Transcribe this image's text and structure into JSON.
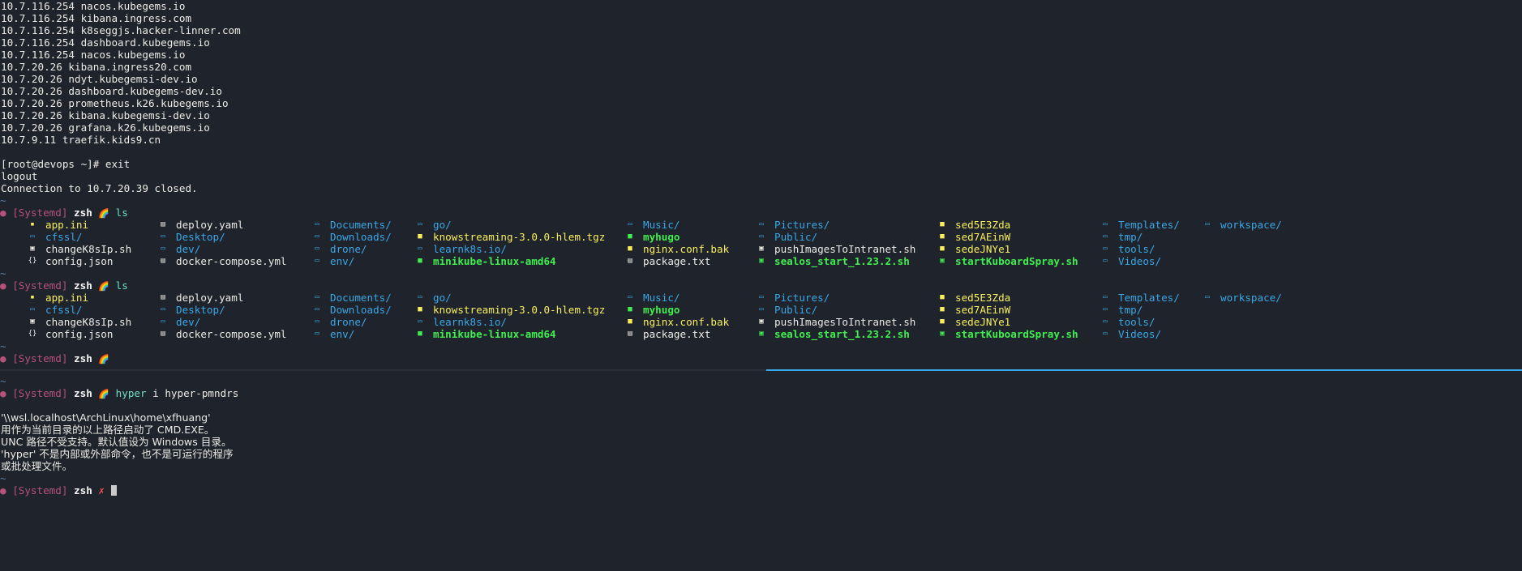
{
  "colors": {
    "background": "#1f232b",
    "text": "#ecebe6",
    "directory": "#3aa7e6",
    "executable": "#42ed51",
    "config_file": "#f8ef5f",
    "prompt_tag": "#b4537a",
    "command_ok": "#6fe0c4",
    "error_mark": "#ff5151",
    "active_pane_border": "#3aa7e6"
  },
  "output": {
    "hosts": [
      "10.7.116.254 nacos.kubegems.io",
      "10.7.116.254 kibana.ingress.com",
      "10.7.116.254 k8seggjs.hacker-linner.com",
      "10.7.116.254 dashboard.kubegems.io",
      "10.7.116.254 nacos.kubegems.io",
      "10.7.20.26 kibana.ingress20.com",
      "10.7.20.26 ndyt.kubegemsi-dev.io",
      "10.7.20.26 dashboard.kubegems-dev.io",
      "10.7.20.26 prometheus.k26.kubegems.io",
      "10.7.20.26 kibana.kubegemsi-dev.io",
      "10.7.20.26 grafana.k26.kubegems.io",
      "10.7.9.11 traefik.kids9.cn"
    ],
    "exit_prompt": "[root@devops ~]# exit",
    "logout": "logout",
    "closed": "Connection to 10.7.20.39 closed."
  },
  "prompt": {
    "tilde": "~",
    "dot": "●",
    "tag": "[Systemd]",
    "shell": "zsh",
    "rainbow": "🌈",
    "error_mark": "✗",
    "cmd_ls": "ls"
  },
  "listing": {
    "rows": [
      [
        {
          "name": "app.ini",
          "type": "config",
          "icon": "settings-file-icon"
        },
        {
          "name": "deploy.yaml",
          "type": "file",
          "icon": "yaml-file-icon"
        },
        {
          "name": "Documents/",
          "type": "dir",
          "icon": "folder-icon"
        },
        {
          "name": "go/",
          "type": "dir",
          "icon": "folder-icon"
        },
        {
          "name": "Music/",
          "type": "dir",
          "icon": "folder-icon"
        },
        {
          "name": "Pictures/",
          "type": "dir",
          "icon": "folder-icon"
        },
        {
          "name": "sed5E3Zda",
          "type": "config",
          "icon": "file-icon"
        },
        {
          "name": "Templates/",
          "type": "dir",
          "icon": "folder-icon"
        },
        {
          "name": "workspace/",
          "type": "dir",
          "icon": "folder-icon"
        }
      ],
      [
        {
          "name": "cfssl/",
          "type": "dir",
          "icon": "folder-icon"
        },
        {
          "name": "Desktop/",
          "type": "dir",
          "icon": "folder-icon"
        },
        {
          "name": "Downloads/",
          "type": "dir",
          "icon": "folder-icon"
        },
        {
          "name": "knowstreaming-3.0.0-hlem.tgz",
          "type": "archive",
          "icon": "archive-icon"
        },
        {
          "name": "myhugo",
          "type": "exe",
          "icon": "executable-icon"
        },
        {
          "name": "Public/",
          "type": "dir",
          "icon": "folder-icon"
        },
        {
          "name": "sed7AEinW",
          "type": "config",
          "icon": "file-icon"
        },
        {
          "name": "tmp/",
          "type": "dir",
          "icon": "folder-icon"
        }
      ],
      [
        {
          "name": "changeK8sIp.sh",
          "type": "file",
          "icon": "shell-script-icon"
        },
        {
          "name": "dev/",
          "type": "dir",
          "icon": "folder-icon"
        },
        {
          "name": "drone/",
          "type": "dir",
          "icon": "folder-icon"
        },
        {
          "name": "learnk8s.io/",
          "type": "dir",
          "icon": "folder-icon"
        },
        {
          "name": "nginx.conf.bak",
          "type": "config",
          "icon": "config-file-icon"
        },
        {
          "name": "pushImagesToIntranet.sh",
          "type": "file",
          "icon": "shell-script-icon"
        },
        {
          "name": "sedeJNYe1",
          "type": "config",
          "icon": "file-icon"
        },
        {
          "name": "tools/",
          "type": "dir",
          "icon": "folder-icon"
        }
      ],
      [
        {
          "name": "config.json",
          "type": "file",
          "icon": "json-file-icon"
        },
        {
          "name": "docker-compose.yml",
          "type": "file",
          "icon": "yaml-file-icon"
        },
        {
          "name": "env/",
          "type": "dir",
          "icon": "folder-icon"
        },
        {
          "name": "minikube-linux-amd64",
          "type": "exe",
          "icon": "executable-icon"
        },
        {
          "name": "package.txt",
          "type": "file",
          "icon": "text-file-icon"
        },
        {
          "name": "sealos_start_1.23.2.sh",
          "type": "exe",
          "icon": "shell-script-icon"
        },
        {
          "name": "startKuboardSpray.sh",
          "type": "exe",
          "icon": "shell-script-icon"
        },
        {
          "name": "Videos/",
          "type": "dir",
          "icon": "folder-icon"
        }
      ]
    ]
  },
  "bottom": {
    "cmd_name": "hyper",
    "cmd_args": " i hyper-pmndrs",
    "error_lines": [
      "'\\\\wsl.localhost\\ArchLinux\\home\\xfhuang'",
      "用作为当前目录的以上路径启动了 CMD.EXE。",
      "UNC 路径不受支持。默认值设为 Windows 目录。",
      "'hyper' 不是内部或外部命令，也不是可运行的程序",
      "或批处理文件。"
    ]
  }
}
